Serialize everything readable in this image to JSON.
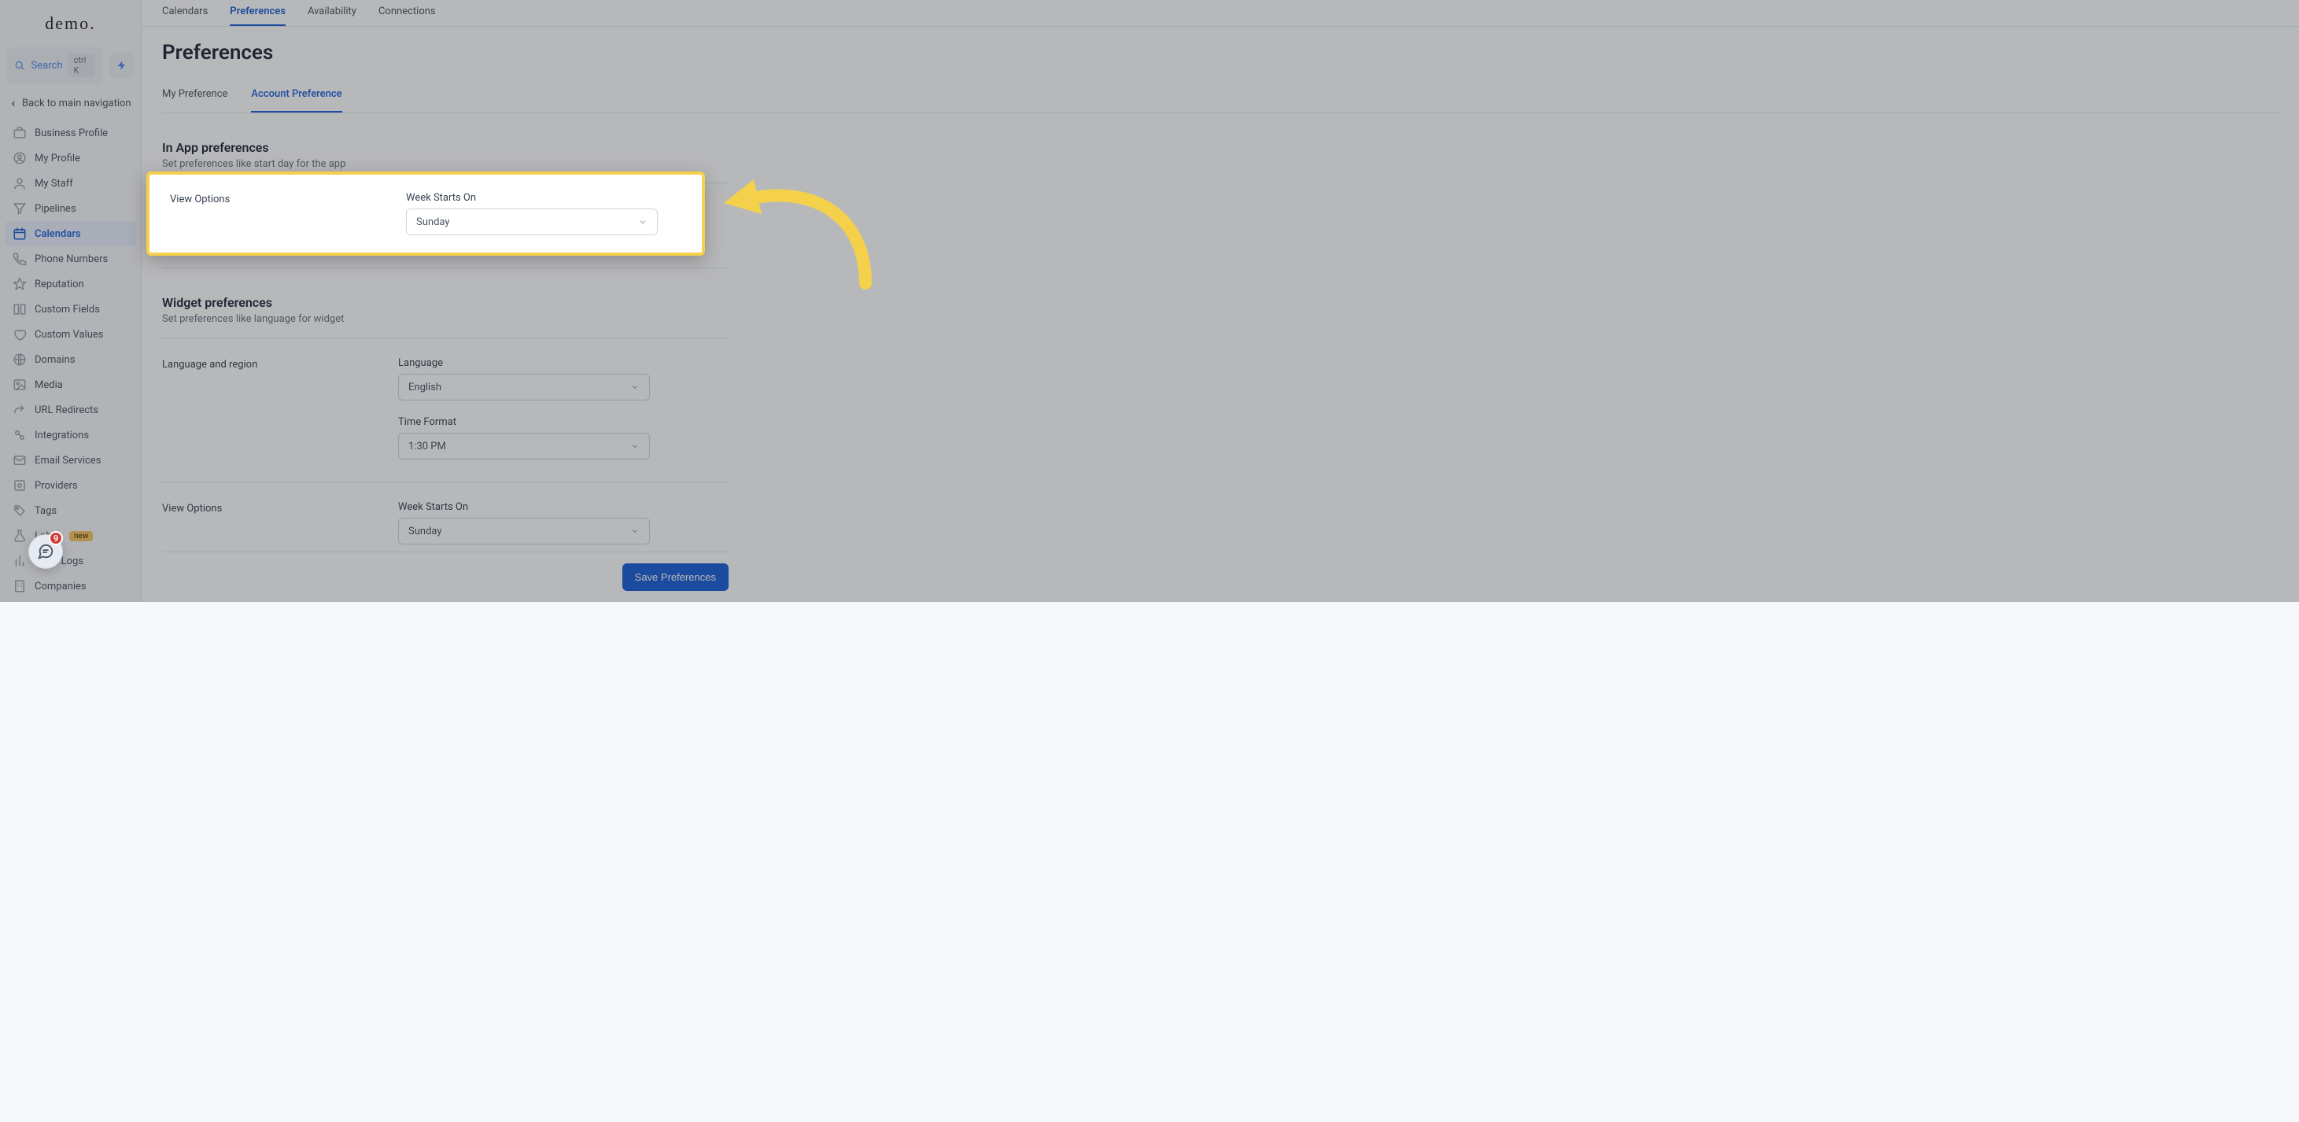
{
  "logo": "demo.",
  "search": {
    "label": "Search",
    "shortcut": "ctrl K"
  },
  "back_link": "Back to main navigation",
  "sidebar": {
    "items": [
      {
        "label": "Business Profile",
        "icon": "briefcase-icon"
      },
      {
        "label": "My Profile",
        "icon": "user-circle-icon"
      },
      {
        "label": "My Staff",
        "icon": "person-icon"
      },
      {
        "label": "Pipelines",
        "icon": "funnel-icon"
      },
      {
        "label": "Calendars",
        "icon": "calendar-icon",
        "active": true
      },
      {
        "label": "Phone Numbers",
        "icon": "phone-icon"
      },
      {
        "label": "Reputation",
        "icon": "star-icon"
      },
      {
        "label": "Custom Fields",
        "icon": "fields-icon"
      },
      {
        "label": "Custom Values",
        "icon": "tag-heart-icon"
      },
      {
        "label": "Domains",
        "icon": "globe-icon"
      },
      {
        "label": "Media",
        "icon": "image-icon"
      },
      {
        "label": "URL Redirects",
        "icon": "redirect-icon"
      },
      {
        "label": "Integrations",
        "icon": "plug-icon"
      },
      {
        "label": "Email Services",
        "icon": "mail-icon"
      },
      {
        "label": "Providers",
        "icon": "provider-icon"
      },
      {
        "label": "Tags",
        "icon": "tag-icon"
      },
      {
        "label": "Labs",
        "icon": "flask-icon",
        "badge": "new"
      },
      {
        "label": "Audit Logs",
        "icon": "chart-icon"
      },
      {
        "label": "Companies",
        "icon": "building-icon"
      }
    ]
  },
  "top_tabs": [
    {
      "label": "Calendars"
    },
    {
      "label": "Preferences",
      "active": true
    },
    {
      "label": "Availability"
    },
    {
      "label": "Connections"
    }
  ],
  "page_title": "Preferences",
  "sub_tabs": [
    {
      "label": "My Preference"
    },
    {
      "label": "Account Preference",
      "active": true
    }
  ],
  "sections": {
    "in_app": {
      "title": "In App preferences",
      "subtitle": "Set preferences like start day for the app",
      "row_label": "View Options",
      "field_label": "Week Starts On",
      "field_value": "Sunday"
    },
    "widget": {
      "title": "Widget preferences",
      "subtitle": "Set preferences like language for widget",
      "lang_row_label": "Language and region",
      "language_label": "Language",
      "language_value": "English",
      "time_format_label": "Time Format",
      "time_format_value": "1:30 PM",
      "view_row_label": "View Options",
      "week_label": "Week Starts On",
      "week_value": "Sunday"
    }
  },
  "save_button": "Save Preferences",
  "notif_count": "9",
  "highlight": {
    "row_label": "View Options",
    "field_label": "Week Starts On",
    "field_value": "Sunday"
  },
  "colors": {
    "accent": "#1a5fd6",
    "highlight_border": "#f5d14b",
    "arrow": "#f5d14b"
  }
}
